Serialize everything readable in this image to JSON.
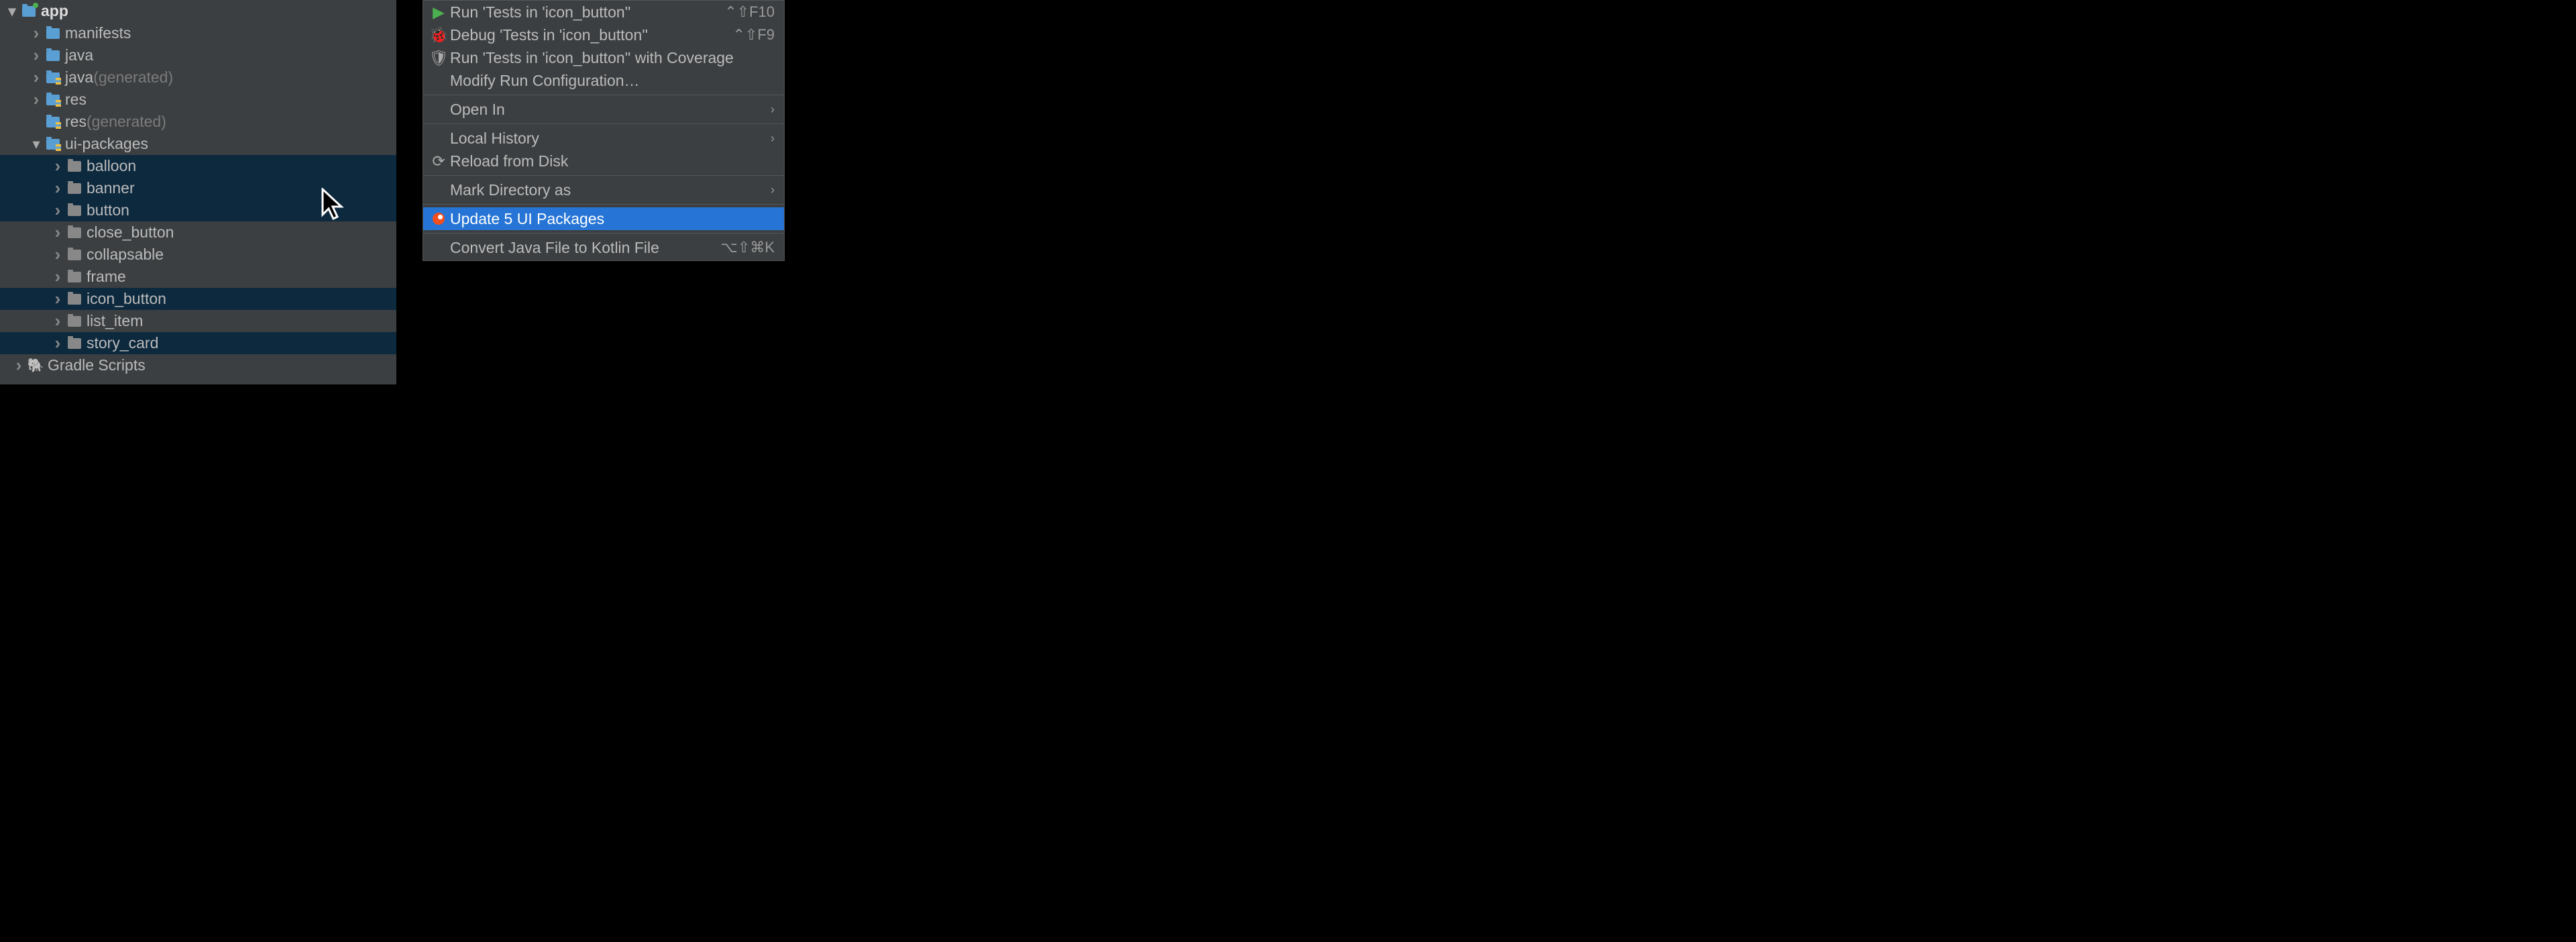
{
  "tree": {
    "app": "app",
    "manifests": "manifests",
    "java": "java",
    "java_gen": "java",
    "java_gen_suffix": " (generated)",
    "res": "res",
    "res_gen": "res",
    "res_gen_suffix": " (generated)",
    "ui_packages": "ui-packages",
    "packages": {
      "balloon": "balloon",
      "banner": "banner",
      "button": "button",
      "close_button": "close_button",
      "collapsable": "collapsable",
      "frame": "frame",
      "icon_button": "icon_button",
      "list_item": "list_item",
      "story_card": "story_card"
    },
    "gradle_scripts": "Gradle Scripts"
  },
  "menu": {
    "run": "Run 'Tests in 'icon_button''",
    "run_shortcut": "⌃⇧F10",
    "debug": "Debug 'Tests in 'icon_button''",
    "debug_shortcut": "⌃⇧F9",
    "coverage": "Run 'Tests in 'icon_button'' with Coverage",
    "modify": "Modify Run Configuration…",
    "open_in": "Open In",
    "local_history": "Local History",
    "reload": "Reload from Disk",
    "mark_dir": "Mark Directory as",
    "update_packages": "Update 5 UI Packages",
    "convert": "Convert Java File to Kotlin File",
    "convert_shortcut": "⌥⇧⌘K"
  }
}
